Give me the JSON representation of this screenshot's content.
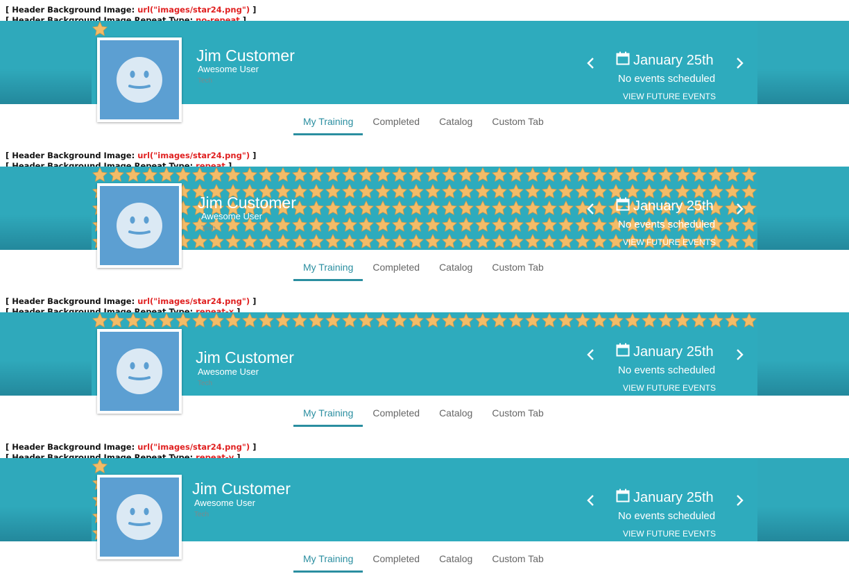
{
  "labels": {
    "prefix1": "[ Header Background Image: ",
    "prefix2": "[ Header Background Image Repeat Type: ",
    "suffix": " ]",
    "url": "url(\"images/star24.png\")"
  },
  "sections": [
    {
      "repeat_type": "no-repeat"
    },
    {
      "repeat_type": "repeat"
    },
    {
      "repeat_type": "repeat-x"
    },
    {
      "repeat_type": "repeat-y"
    }
  ],
  "profile": {
    "name": "Jim Customer",
    "role": "Awesome User",
    "department": "Tech"
  },
  "events": {
    "date": "January 25th",
    "status": "No events scheduled",
    "link": "VIEW FUTURE EVENTS"
  },
  "tabs": [
    "My Training",
    "Completed",
    "Catalog",
    "Custom Tab"
  ],
  "active_tab_index": 0,
  "icons": {
    "avatar": "smiley-face-icon",
    "calendar": "calendar-icon",
    "prev": "chevron-left-icon",
    "next": "chevron-right-icon",
    "background": "star-icon"
  },
  "colors": {
    "header": "#2eabbd",
    "accent": "#2a8ea0",
    "label_value": "#e02020",
    "star": "#f2bb66"
  }
}
